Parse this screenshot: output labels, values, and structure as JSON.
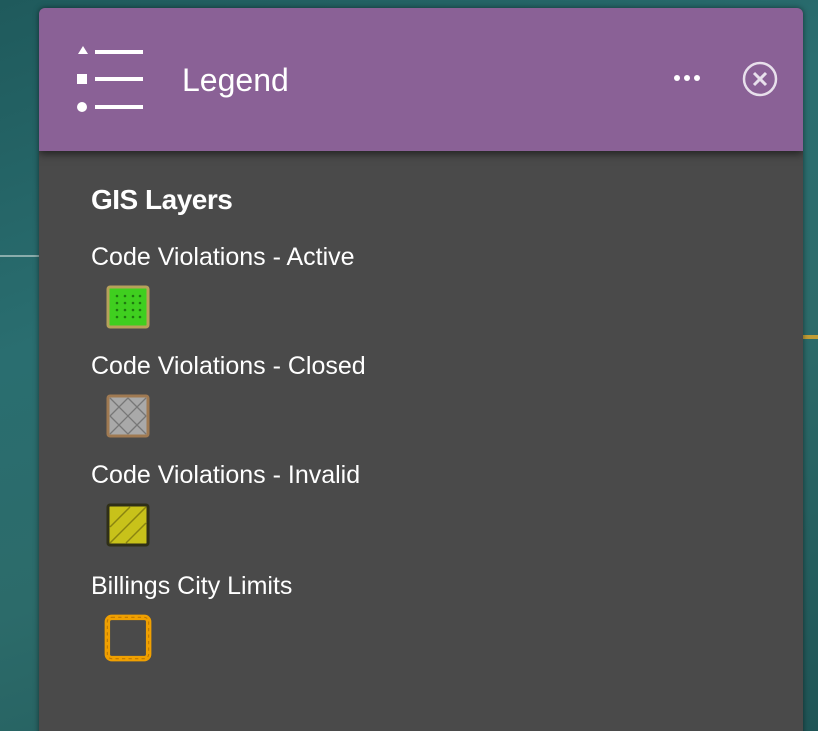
{
  "panel": {
    "title": "Legend",
    "more_label": "more-options",
    "close_label": "close",
    "header_color": "#8a6196",
    "body_color": "#4a4a4a"
  },
  "legend": {
    "section_title": "GIS Layers",
    "layers": [
      {
        "label": "Code Violations - Active",
        "symbol": "green-dotted-fill",
        "fill": "#3fcf1f",
        "outline": "#b7a15a"
      },
      {
        "label": "Code Violations - Closed",
        "symbol": "gray-crosshatch-fill",
        "fill": "#a9a9a9",
        "outline": "#a07a52"
      },
      {
        "label": "Code Violations - Invalid",
        "symbol": "yellow-diagonal-fill",
        "fill": "#c8c21a",
        "outline": "#3a3a1a"
      },
      {
        "label": "Billings City Limits",
        "symbol": "orange-dashed-outline",
        "fill": "none",
        "outline": "#f0a000"
      }
    ]
  }
}
